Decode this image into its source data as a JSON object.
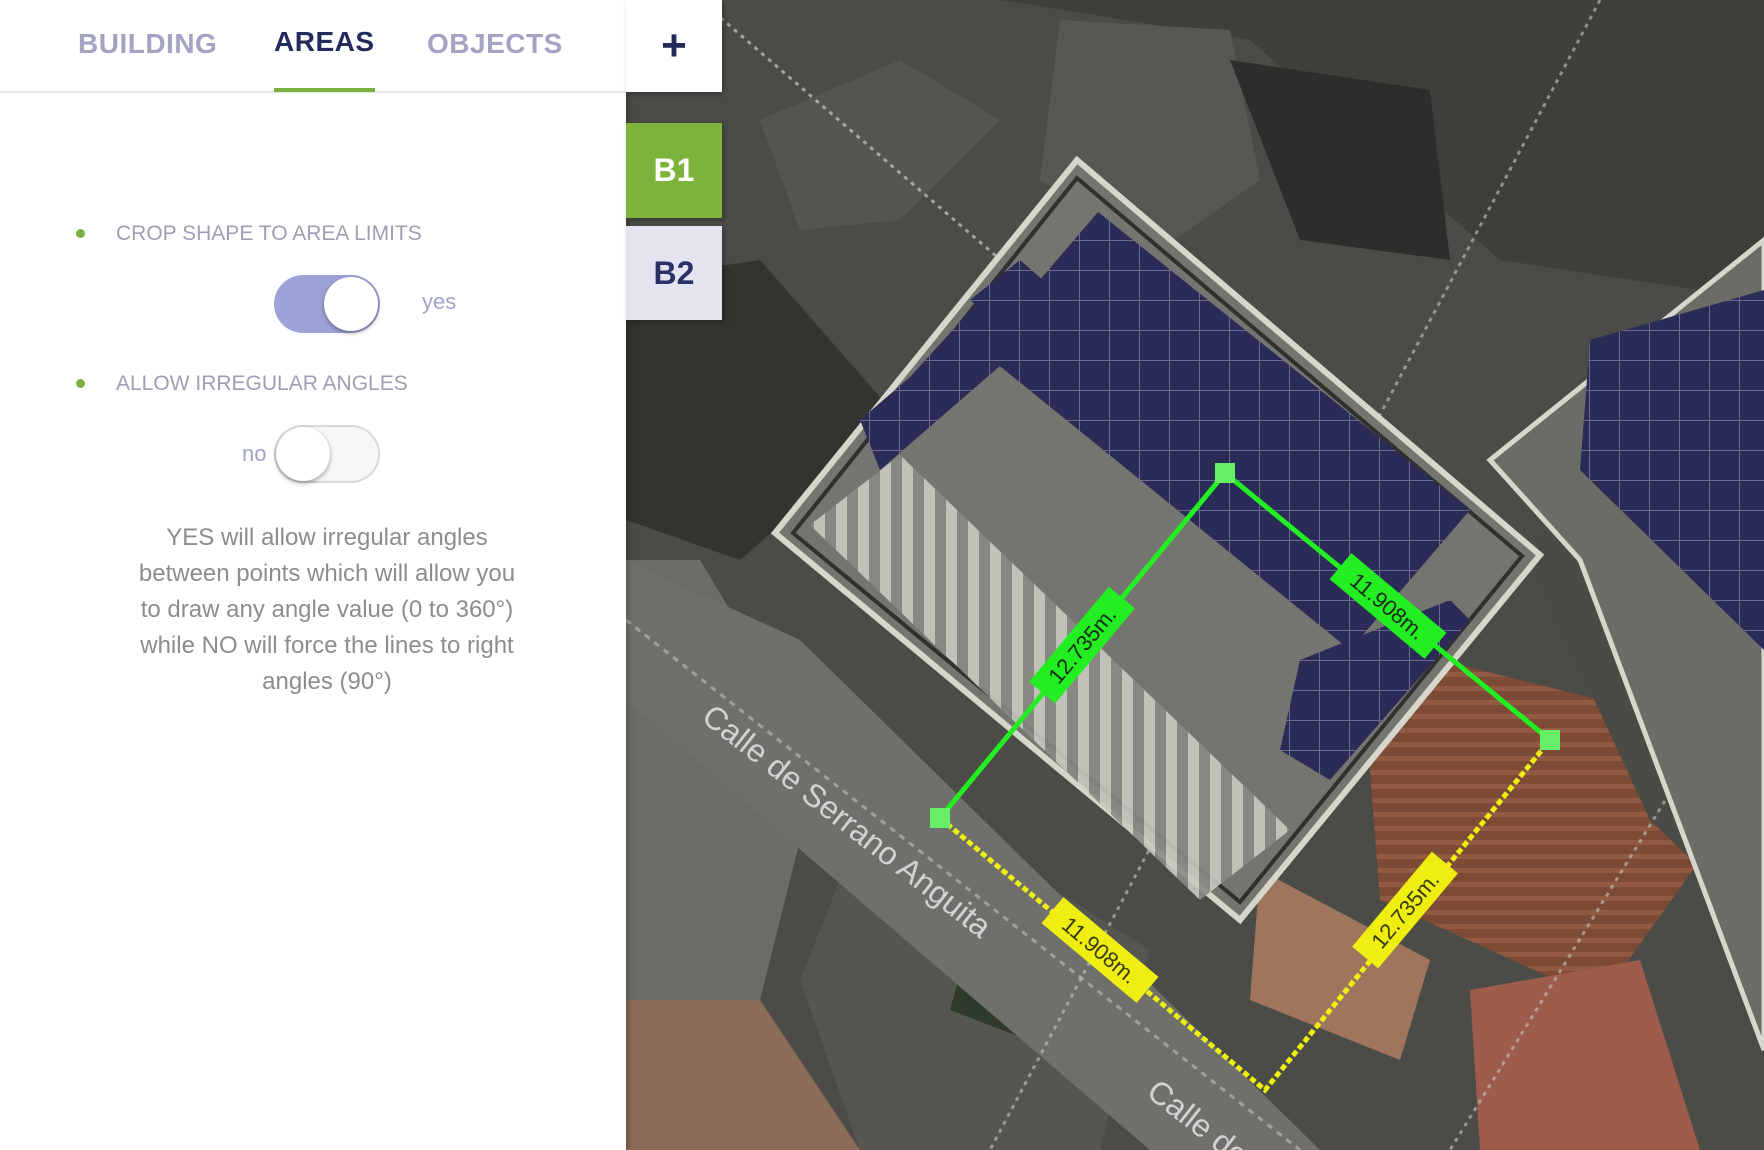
{
  "tabs": [
    {
      "label": "BUILDING",
      "active": false
    },
    {
      "label": "AREAS",
      "active": true
    },
    {
      "label": "OBJECTS",
      "active": false
    }
  ],
  "settings": {
    "crop": {
      "label": "CROP SHAPE TO AREA LIMITS",
      "state_text": "yes",
      "on": true
    },
    "irregular": {
      "label": "ALLOW IRREGULAR ANGLES",
      "state_text": "no",
      "on": false
    }
  },
  "help_text": "YES will allow irregular angles between points which will allow you to draw any angle value (0 to 360°) while NO will force the lines to right angles (90°)",
  "side_buttons": {
    "add_icon": "plus-icon",
    "add_label": "+",
    "buildings": [
      {
        "label": "B1",
        "selected": true
      },
      {
        "label": "B2",
        "selected": false
      }
    ]
  },
  "map": {
    "green_measurements": [
      "12.735m.",
      "11.908m."
    ],
    "yellow_measurements": [
      "11.908m.",
      "12.735m."
    ],
    "street_labels": [
      "Calle de Serrano Anguita",
      "Calle de"
    ],
    "colors": {
      "accent_green": "#79b23e",
      "measure_green": "#22ee22",
      "measure_yellow": "#eeee11",
      "panel_blue": "#2b2b58",
      "toggle_on": "#9da3d6"
    }
  }
}
